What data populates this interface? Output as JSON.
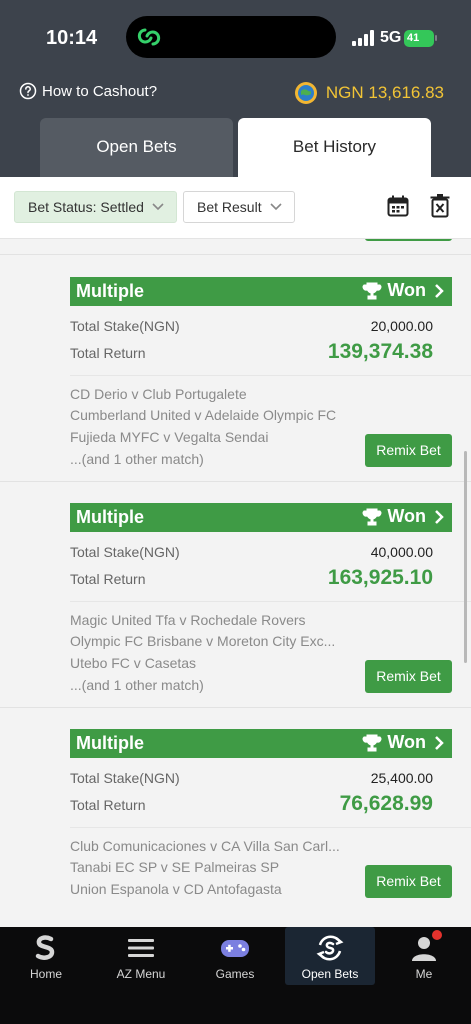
{
  "status_bar": {
    "time": "10:14",
    "network": "5G",
    "battery": "41"
  },
  "header": {
    "howto_label": "How to Cashout?",
    "balance": "NGN 13,616.83"
  },
  "tabs": [
    {
      "label": "Open Bets",
      "active": false
    },
    {
      "label": "Bet History",
      "active": true
    }
  ],
  "filters": {
    "status_label": "Bet Status: Settled",
    "result_label": "Bet Result"
  },
  "bets": [
    {
      "type": "Multiple",
      "status": "Won",
      "stake_label": "Total Stake(NGN)",
      "stake": "20,000.00",
      "return_label": "Total Return",
      "return": "139,374.38",
      "matches": [
        "CD Derio v Club Portugalete",
        "Cumberland United v Adelaide Olympic FC",
        "Fujieda MYFC v Vegalta Sendai",
        "...(and 1 other match)"
      ],
      "remix_label": "Remix Bet"
    },
    {
      "type": "Multiple",
      "status": "Won",
      "stake_label": "Total Stake(NGN)",
      "stake": "40,000.00",
      "return_label": "Total Return",
      "return": "163,925.10",
      "matches": [
        "Magic United Tfa v Rochedale Rovers",
        "Olympic FC Brisbane v Moreton City Exc...",
        "Utebo FC v Casetas",
        "...(and 1 other match)"
      ],
      "remix_label": "Remix Bet"
    },
    {
      "type": "Multiple",
      "status": "Won",
      "stake_label": "Total Stake(NGN)",
      "stake": "25,400.00",
      "return_label": "Total Return",
      "return": "76,628.99",
      "matches": [
        "Club Comunicaciones v CA Villa San Carl...",
        "Tanabi EC SP v SE Palmeiras SP",
        "Union Espanola v CD Antofagasta"
      ],
      "remix_label": "Remix Bet"
    }
  ],
  "nav": [
    {
      "label": "Home",
      "icon": "sporty-logo-icon"
    },
    {
      "label": "AZ Menu",
      "icon": "menu-icon"
    },
    {
      "label": "Games",
      "icon": "gamepad-icon"
    },
    {
      "label": "Open Bets",
      "icon": "open-bets-icon",
      "active": true
    },
    {
      "label": "Me",
      "icon": "user-icon"
    }
  ],
  "colors": {
    "accent": "#3f9b45",
    "header": "#3d434c",
    "balance": "#f2c436"
  }
}
